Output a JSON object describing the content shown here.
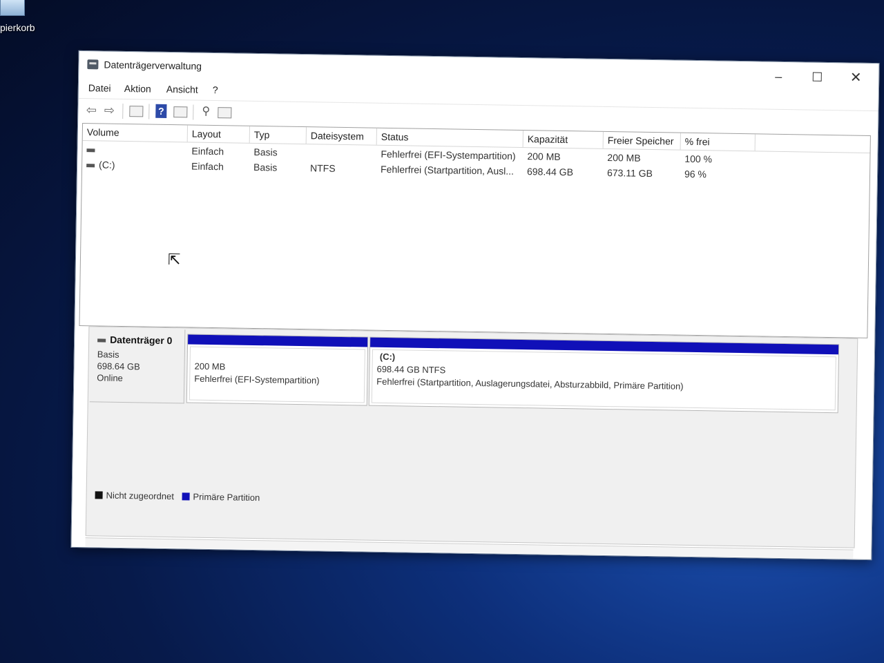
{
  "desktop": {
    "recycle_bin_label": "pierkorb"
  },
  "window": {
    "title": "Datenträgerverwaltung",
    "minimize_glyph": "–",
    "maximize_glyph": "☐",
    "close_glyph": "✕"
  },
  "menu": [
    "Datei",
    "Aktion",
    "Ansicht",
    "?"
  ],
  "toolbar": {
    "icons": [
      "back-arrow-icon",
      "forward-arrow-icon",
      "console-tree-icon",
      "help-icon",
      "properties-icon",
      "connect-icon",
      "settings-icon"
    ],
    "back_glyph": "⇦",
    "forward_glyph": "⇨",
    "help_glyph": "?"
  },
  "volume_list": {
    "columns": [
      "Volume",
      "Layout",
      "Typ",
      "Dateisystem",
      "Status",
      "Kapazität",
      "Freier Speicher",
      "% frei"
    ],
    "rows": [
      {
        "volume": "",
        "layout": "Einfach",
        "type": "Basis",
        "filesystem": "",
        "status": "Fehlerfrei (EFI-Systempartition)",
        "capacity": "200 MB",
        "free": "200 MB",
        "percent_free": "100 %"
      },
      {
        "volume": "(C:)",
        "layout": "Einfach",
        "type": "Basis",
        "filesystem": "NTFS",
        "status": "Fehlerfrei (Startpartition, Ausl...",
        "capacity": "698.44 GB",
        "free": "673.11 GB",
        "percent_free": "96 %"
      }
    ]
  },
  "disk": {
    "name": "Datenträger 0",
    "type": "Basis",
    "size": "698.64 GB",
    "state": "Online",
    "partitions": [
      {
        "label": "",
        "size": "200 MB",
        "status": "Fehlerfrei (EFI-Systempartition)",
        "color": "#1010b8"
      },
      {
        "label": "(C:)",
        "size": "698.44 GB NTFS",
        "status": "Fehlerfrei (Startpartition, Auslagerungsdatei, Absturzabbild, Primäre Partition)",
        "color": "#1010b8"
      }
    ]
  },
  "legend": [
    {
      "label": "Nicht zugeordnet",
      "color": "#111111"
    },
    {
      "label": "Primäre Partition",
      "color": "#1010b8"
    }
  ]
}
